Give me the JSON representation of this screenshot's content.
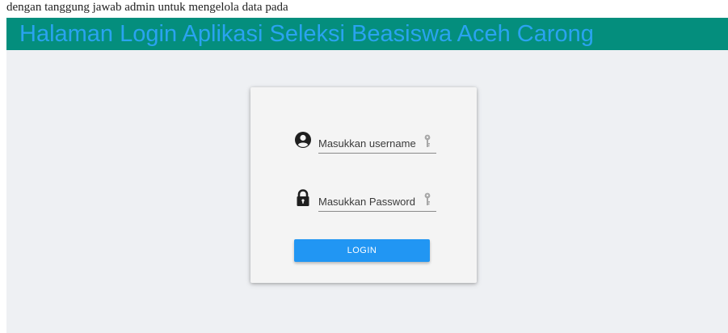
{
  "page_caption": "dengan tanggung jawab admin untuk mengelola data pada",
  "header": {
    "title": "Halaman Login Aplikasi Seleksi Beasiswa Aceh Carong",
    "background_color": "#048e7d",
    "title_color": "#2aa3f0"
  },
  "login_form": {
    "username": {
      "placeholder": "Masukkan username",
      "value": "",
      "icon": "user-circle-icon",
      "trailing_icon": "key-icon"
    },
    "password": {
      "placeholder": "Masukkan Password",
      "value": "",
      "icon": "lock-icon",
      "trailing_icon": "key-icon"
    },
    "submit_label": "LOGIN",
    "submit_color": "#2196f3"
  }
}
